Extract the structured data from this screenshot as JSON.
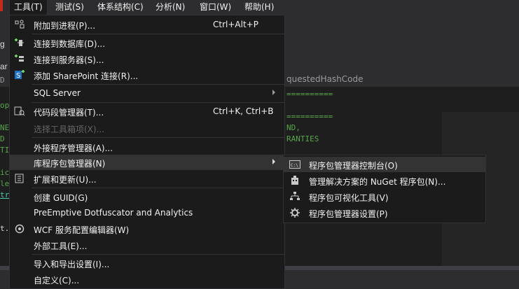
{
  "menubar": {
    "items": [
      {
        "label": "工具(T)",
        "active": true
      },
      {
        "label": "测试(S)"
      },
      {
        "label": "体系结构(C)"
      },
      {
        "label": "分析(N)"
      },
      {
        "label": "窗口(W)"
      },
      {
        "label": "帮助(H)"
      }
    ]
  },
  "background": {
    "tab_text": "questedHashCode",
    "left_fragments": [
      "g",
      "ar",
      "D",
      "op",
      "NE",
      "D",
      "TI",
      "ic",
      "le",
      "tr",
      "t."
    ],
    "equals_1": "==========",
    "equals_2": "==========",
    "code_1": "ND,",
    "code_2": "RANTIES"
  },
  "tools_menu": {
    "items": [
      {
        "label": "附加到进程(P)...",
        "shortcut": "Ctrl+Alt+P",
        "icon": "attach-process-icon"
      },
      {
        "label": "连接到数据库(D)...",
        "icon": "connect-database-icon"
      },
      {
        "label": "连接到服务器(S)...",
        "icon": "connect-server-icon"
      },
      {
        "label": "添加 SharePoint 连接(R)...",
        "icon": "sharepoint-icon"
      },
      {
        "label": "SQL Server"
      },
      {
        "label": "代码段管理器(T)...",
        "shortcut": "Ctrl+K, Ctrl+B",
        "icon": "snippet-manager-icon"
      },
      {
        "label": "选择工具箱项(X)...",
        "disabled": true
      },
      {
        "label": "外接程序管理器(A)..."
      },
      {
        "label": "库程序包管理器(N)"
      },
      {
        "label": "扩展和更新(U)...",
        "icon": "extensions-icon"
      },
      {
        "label": "创建 GUID(G)"
      },
      {
        "label": "PreEmptive Dotfuscator and Analytics"
      },
      {
        "label": "WCF 服务配置编辑器(W)",
        "icon": "wcf-icon"
      },
      {
        "label": "外部工具(E)..."
      },
      {
        "label": "导入和导出设置(I)..."
      },
      {
        "label": "自定义(C)..."
      }
    ]
  },
  "package_submenu": {
    "items": [
      {
        "label": "程序包管理器控制台(O)",
        "icon": "console-icon"
      },
      {
        "label": "管理解决方案的 NuGet 程序包(N)...",
        "icon": "nuget-package-icon"
      },
      {
        "label": "程序包可视化工具(V)",
        "icon": "visualizer-icon"
      },
      {
        "label": "程序包管理器设置(P)",
        "icon": "settings-gear-icon"
      }
    ]
  },
  "colors": {
    "menu_bg": "#1b1b1c",
    "hover": "#333334",
    "text": "#f1f1f1",
    "comment_green": "#57a64a",
    "accent_green": "#6bd35b"
  }
}
